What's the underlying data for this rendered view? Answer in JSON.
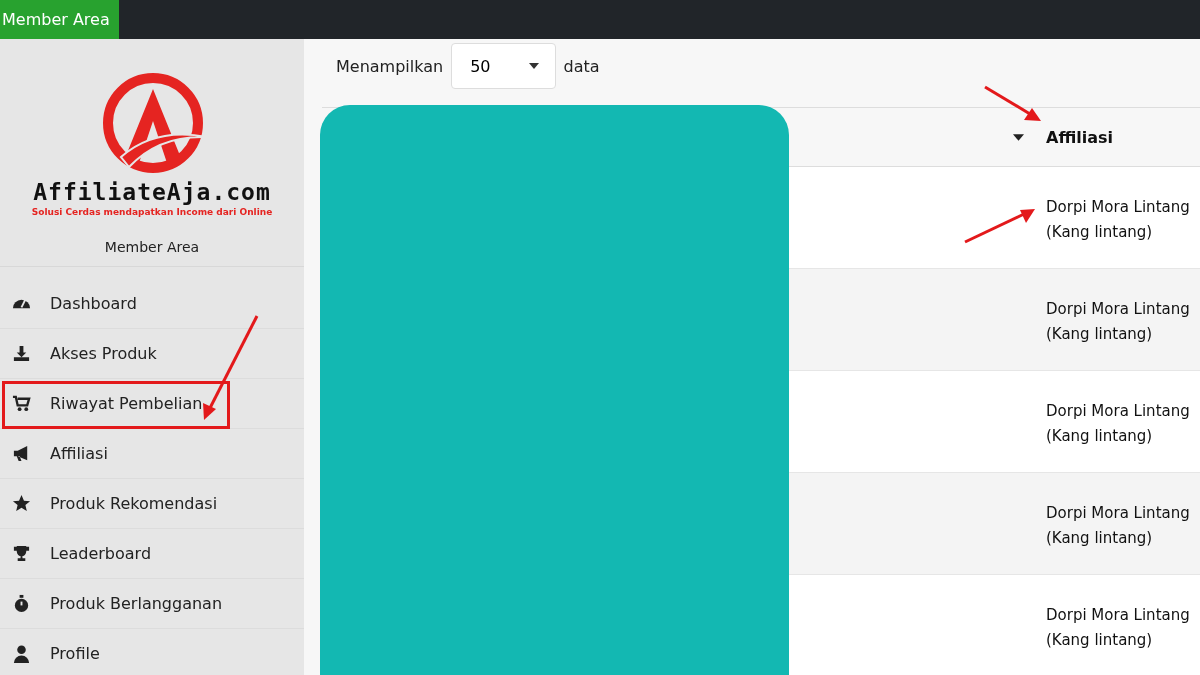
{
  "top_bar": {
    "label": "Member Area"
  },
  "sidebar": {
    "brand": "AffiliateAja.com",
    "tagline": "Solusi Cerdas mendapatkan Income dari Online",
    "subtitle": "Member Area",
    "items": [
      {
        "label": "Dashboard",
        "highlighted": false
      },
      {
        "label": "Akses Produk",
        "highlighted": false
      },
      {
        "label": "Riwayat Pembelian",
        "highlighted": true
      },
      {
        "label": "Affiliasi",
        "highlighted": false
      },
      {
        "label": "Produk Rekomendasi",
        "highlighted": false
      },
      {
        "label": "Leaderboard",
        "highlighted": false
      },
      {
        "label": "Produk Berlangganan",
        "highlighted": false
      },
      {
        "label": "Profile",
        "highlighted": false
      }
    ]
  },
  "length_control": {
    "before": "Menampilkan",
    "value": "50",
    "after": "data"
  },
  "table": {
    "columns": [
      "Affiliasi"
    ],
    "rows": [
      {
        "affiliate": "Dorpi Mora Lintang",
        "alias": "(Kang lintang)"
      },
      {
        "affiliate": "Dorpi Mora Lintang",
        "alias": "(Kang lintang)"
      },
      {
        "affiliate": "Dorpi Mora Lintang",
        "alias": "(Kang lintang)"
      },
      {
        "affiliate": "Dorpi Mora Lintang",
        "alias": "(Kang lintang)"
      },
      {
        "affiliate": "Dorpi Mora Lintang",
        "alias": "(Kang lintang)"
      }
    ]
  }
}
